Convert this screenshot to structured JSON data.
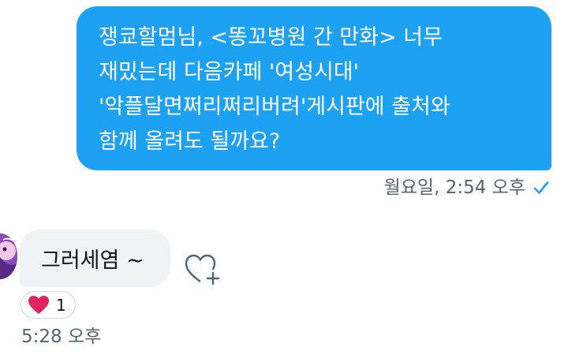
{
  "sent_message": {
    "lines": [
      "쟁쿄할멈님, <똥꼬병원 간 만화> 너무",
      "재밌는데 다음카페 '여성시대'",
      "'악플달면쩌리쩌리버려'게시판에 출처와",
      "함께 올려도 될까요?"
    ],
    "timestamp": "월요일, 2:54 오후",
    "status_icon": "check-icon"
  },
  "received_message": {
    "text": "그러세염 ~",
    "reaction": {
      "icon": "heart-icon",
      "count": "1"
    },
    "timestamp": "5:28 오후"
  },
  "colors": {
    "sent_bubble": "#1da1f2",
    "received_bubble": "#eff3f4",
    "heart": "#e0245e",
    "meta_text": "#536471"
  }
}
